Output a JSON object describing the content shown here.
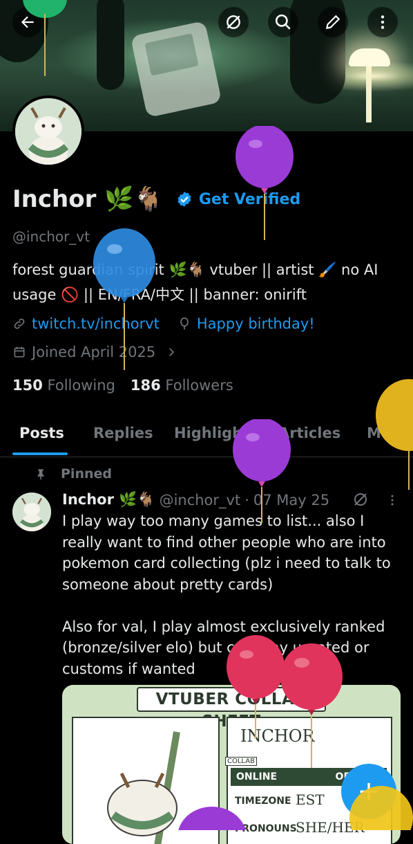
{
  "header": {
    "back_icon": "arrow-left-icon",
    "actions": [
      "grok-icon",
      "search-icon",
      "edit-icon",
      "more-vertical-icon"
    ]
  },
  "profile": {
    "name": "Inchor 🌿🐐",
    "verified_label": "Get Verified",
    "handle": "@inchor_vt",
    "bio": "forest guardian spirit 🌿🐐 vtuber || artist 🖌️ no AI usage 🚫 || EN/FRA/中文 || banner: onirift",
    "link": "twitch.tv/inchorvt",
    "birthday": "Happy birthday!",
    "joined": "Joined April 2025",
    "following_count": "150",
    "following_label": "Following",
    "followers_count": "186",
    "followers_label": "Followers"
  },
  "tabs": [
    {
      "label": "Posts"
    },
    {
      "label": "Replies"
    },
    {
      "label": "Highlights"
    },
    {
      "label": "Articles"
    },
    {
      "label": "Media"
    }
  ],
  "post": {
    "pinned_label": "Pinned",
    "author": "Inchor 🌿🐐",
    "handle": "@inchor_vt",
    "separator": "·",
    "date": "07 May 25",
    "text": "I play way too many games to list... also I really want to find other people who are into pokemon card collecting (plz i need to talk to someone about pretty cards)\n\nAlso for val, I play almost exclusively ranked (bronze/silver elo) but can play unrated or customs if wanted",
    "card": {
      "title": "VTUBER COLLAB SHEET",
      "name": "INCHOR",
      "collab_tag": "COLLAB",
      "online": "ONLINE",
      "offline": "OFFLINE",
      "timezone_label": "TIMEZONE",
      "timezone_value": "EST",
      "pronouns_label": "PRONOUNS",
      "pronouns_value": "SHE/HER"
    }
  },
  "fab": {
    "label": "+"
  },
  "colors": {
    "accent": "#1d9bf0",
    "muted": "#71767b",
    "text": "#e7e9ea",
    "background": "#000000"
  }
}
